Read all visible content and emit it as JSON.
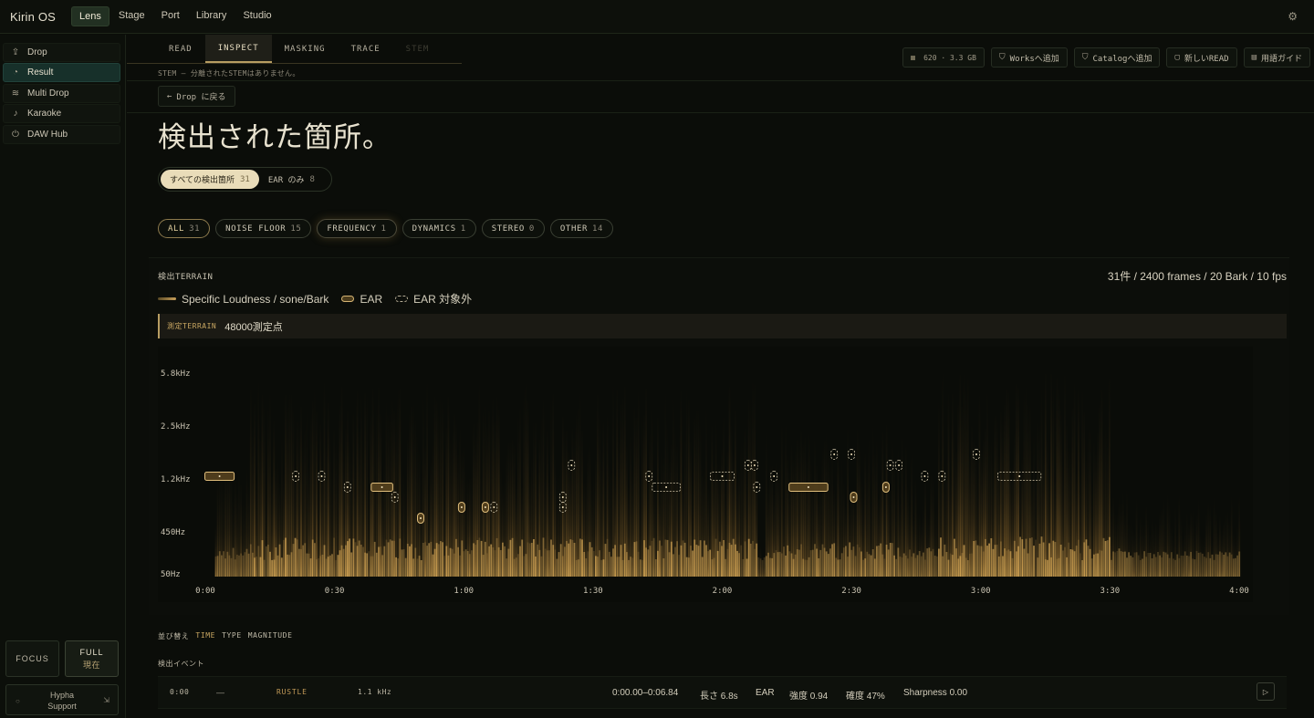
{
  "app": {
    "brand": "Kirin OS",
    "nav": [
      {
        "label": "Lens",
        "active": true
      },
      {
        "label": "Stage"
      },
      {
        "label": "Port"
      },
      {
        "label": "Library"
      },
      {
        "label": "Studio"
      }
    ],
    "settings_icon": "gear-icon"
  },
  "sidebar": {
    "items": [
      {
        "label": "Drop",
        "icon": "upload-icon",
        "glyph": "⇪"
      },
      {
        "label": "Result",
        "icon": "gauge-icon",
        "glyph": "◔",
        "active": true
      },
      {
        "label": "Multi Drop",
        "icon": "layers-icon",
        "glyph": "≋"
      },
      {
        "label": "Karaoke",
        "icon": "mic-icon",
        "glyph": "♪"
      },
      {
        "label": "DAW Hub",
        "icon": "plug-icon",
        "glyph": "⏻"
      }
    ],
    "modes": {
      "focus": "FOCUS",
      "full": "FULL",
      "full_sub": "現在"
    },
    "support": {
      "line1": "Hypha",
      "line2": "Support"
    }
  },
  "subtabs": [
    "READ",
    "INSPECT",
    "MASKING",
    "TRACE",
    "STEM"
  ],
  "stem_note": "STEM — 分離されたSTEMはありません。",
  "toolbar": {
    "stat": "620 · 3.3 GB",
    "works": "Worksへ追加",
    "catalog": "Catalogへ追加",
    "new_read": "新しいREAD",
    "glossary": "用語ガイド"
  },
  "back_label": "Drop に戻る",
  "page_title": "検出された箇所。",
  "segment": {
    "all": {
      "label": "すべての検出箇所",
      "count": "31"
    },
    "ear": {
      "label": "EAR のみ",
      "count": "8"
    }
  },
  "filters": [
    {
      "label": "ALL",
      "count": "31",
      "active": true
    },
    {
      "label": "NOISE FLOOR",
      "count": "15"
    },
    {
      "label": "FREQUENCY",
      "count": "1",
      "glow": true
    },
    {
      "label": "DYNAMICS",
      "count": "1"
    },
    {
      "label": "STEREO",
      "count": "0"
    },
    {
      "label": "OTHER",
      "count": "14"
    }
  ],
  "terrain": {
    "label": "検出TERRAIN",
    "meta": "31件 / 2400 frames / 20 Bark / 10 fps",
    "legend": [
      "Specific Loudness / sone/Bark",
      "EAR",
      "EAR 対象外"
    ],
    "measure_key": "測定TERRAIN",
    "measure_value": "48000測定点"
  },
  "chart_data": {
    "type": "heatmap",
    "y_ticks": [
      "5.8kHz",
      "2.5kHz",
      "1.2kHz",
      "450Hz",
      "50Hz"
    ],
    "x_ticks": [
      "0:00",
      "0:30",
      "1:00",
      "1:30",
      "2:00",
      "2:30",
      "3:00",
      "3:30",
      "4:00"
    ],
    "x_range_seconds": [
      0,
      240
    ],
    "markers": [
      {
        "t": 3.3,
        "freq": "1.2kHz",
        "ear": true,
        "duration": 6.8
      },
      {
        "t": 21,
        "freq": "1.2kHz",
        "ear": false
      },
      {
        "t": 27,
        "freq": "1.2kHz",
        "ear": false
      },
      {
        "t": 33,
        "freq": "1.0kHz",
        "ear": false
      },
      {
        "t": 41,
        "freq": "1.0kHz",
        "ear": true,
        "duration": 5
      },
      {
        "t": 44,
        "freq": "900Hz",
        "ear": false
      },
      {
        "t": 50,
        "freq": "650Hz",
        "ear": true
      },
      {
        "t": 59.5,
        "freq": "750Hz",
        "ear": true
      },
      {
        "t": 65,
        "freq": "750Hz",
        "ear": true
      },
      {
        "t": 67,
        "freq": "750Hz",
        "ear": false
      },
      {
        "t": 83,
        "freq": "900Hz",
        "ear": false
      },
      {
        "t": 83,
        "freq": "750Hz",
        "ear": false
      },
      {
        "t": 85,
        "freq": "1.3kHz",
        "ear": false
      },
      {
        "t": 103,
        "freq": "1.2kHz",
        "ear": false
      },
      {
        "t": 107,
        "freq": "1.0kHz",
        "ear": false,
        "duration": 6.5
      },
      {
        "t": 120,
        "freq": "1.2kHz",
        "ear": false,
        "duration": 5.5
      },
      {
        "t": 126,
        "freq": "1.3kHz",
        "ear": false
      },
      {
        "t": 127.5,
        "freq": "1.3kHz",
        "ear": false
      },
      {
        "t": 128,
        "freq": "1.0kHz",
        "ear": false
      },
      {
        "t": 132,
        "freq": "1.2kHz",
        "ear": false
      },
      {
        "t": 140,
        "freq": "1.0kHz",
        "ear": true,
        "duration": 9
      },
      {
        "t": 146,
        "freq": "1.5kHz",
        "ear": false
      },
      {
        "t": 150,
        "freq": "1.5kHz",
        "ear": false
      },
      {
        "t": 150.5,
        "freq": "900Hz",
        "ear": true
      },
      {
        "t": 158,
        "freq": "1.0kHz",
        "ear": true
      },
      {
        "t": 159,
        "freq": "1.3kHz",
        "ear": false
      },
      {
        "t": 161,
        "freq": "1.3kHz",
        "ear": false
      },
      {
        "t": 167,
        "freq": "1.2kHz",
        "ear": false
      },
      {
        "t": 171,
        "freq": "1.2kHz",
        "ear": false
      },
      {
        "t": 179,
        "freq": "1.5kHz",
        "ear": false
      },
      {
        "t": 189,
        "freq": "1.2kHz",
        "ear": false,
        "duration": 10
      }
    ]
  },
  "sort": {
    "label": "並び替え",
    "options": [
      "TIME",
      "TYPE",
      "MAGNITUDE"
    ],
    "active": "TIME"
  },
  "events_label": "検出イベント",
  "events": [
    {
      "time": "0:00",
      "dash": "—",
      "type": "RUSTLE",
      "freq": "1.1 kHz",
      "range": "0:00.00–0:06.84",
      "length": "長さ 6.8s",
      "ear": "EAR",
      "intensity": "強度 0.94",
      "confidence": "確度 47%",
      "sharpness": "Sharpness 0.00",
      "play_icon": "play-icon"
    }
  ]
}
